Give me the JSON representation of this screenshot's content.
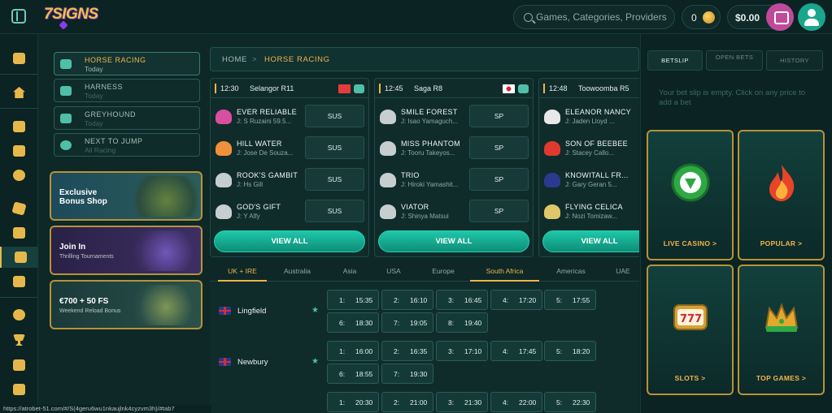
{
  "header": {
    "logo_text": "7SIGNS",
    "search_placeholder": "Games, Categories, Providers",
    "coins": "0",
    "balance": "$0.00"
  },
  "subnav": [
    {
      "label": "HORSE RACING",
      "sub": "Today"
    },
    {
      "label": "HARNESS",
      "sub": "Today"
    },
    {
      "label": "GREYHOUND",
      "sub": "Today"
    },
    {
      "label": "NEXT TO JUMP",
      "sub": "All Racing"
    }
  ],
  "promos": [
    {
      "title": "Exclusive",
      "title2": "Bonus Shop",
      "sub": ""
    },
    {
      "title": "Join In",
      "title2": "",
      "sub": "Thrilling Tournaments"
    },
    {
      "title": "€700 + 50 FS",
      "title2": "",
      "sub": "Weekend Reload Bonus"
    }
  ],
  "breadcrumb": {
    "home": "HOME",
    "separator": ">",
    "current": "HORSE RACING"
  },
  "races": [
    {
      "time": "12:30",
      "venue": "Selangor R11",
      "flag_color": "#e43b3b",
      "runners": [
        {
          "name": "EVER RELIABLE",
          "jockey": "J: S Ruzaini 59.5...",
          "odds": "SUS",
          "silk": "#d84fa0"
        },
        {
          "name": "HILL WATER",
          "jockey": "J: Jose De Souza...",
          "odds": "SUS",
          "silk": "#f0903a"
        },
        {
          "name": "ROOK'S GAMBIT",
          "jockey": "J: Hs Gill",
          "odds": "SUS",
          "silk": "#c7ced0"
        },
        {
          "name": "GOD'S GIFT",
          "jockey": "J: Y Alfy",
          "odds": "SUS",
          "silk": "#c7ced0"
        }
      ],
      "view_all": "VIEW ALL"
    },
    {
      "time": "12:45",
      "venue": "Saga R8",
      "flag_color": "#ffffff",
      "runners": [
        {
          "name": "SMILE FOREST",
          "jockey": "J: Isao Yamaguch...",
          "odds": "SP",
          "silk": "#c7ced0"
        },
        {
          "name": "MISS PHANTOM",
          "jockey": "J: Tooru Takeyos...",
          "odds": "SP",
          "silk": "#c7ced0"
        },
        {
          "name": "TRIO",
          "jockey": "J: Hiroki Yamashit...",
          "odds": "SP",
          "silk": "#c7ced0"
        },
        {
          "name": "VIATOR",
          "jockey": "J: Shinya Matsui",
          "odds": "SP",
          "silk": "#c7ced0"
        }
      ],
      "view_all": "VIEW ALL"
    },
    {
      "time": "12:48",
      "venue": "Toowoomba R5",
      "flag_color": "",
      "runners": [
        {
          "name": "ELEANOR NANCY",
          "jockey": "J: Jaden Lloyd ...",
          "odds": "",
          "silk": "#e8e8e8"
        },
        {
          "name": "SON OF BEEBEE",
          "jockey": "J: Stacey Callo...",
          "odds": "",
          "silk": "#e03a2e"
        },
        {
          "name": "KNOWITALL FR...",
          "jockey": "J: Gary Geran 5...",
          "odds": "",
          "silk": "#2b3a8f"
        },
        {
          "name": "FLYING CELICA",
          "jockey": "J: Nozi Tomizaw...",
          "odds": "",
          "silk": "#e0c86a"
        }
      ],
      "view_all": "VIEW ALL"
    }
  ],
  "regions": [
    "UK + IRE",
    "Australia",
    "Asia",
    "USA",
    "Europe",
    "South Africa",
    "Americas",
    "UAE"
  ],
  "meetings": [
    {
      "name": "Lingfield",
      "races": [
        {
          "n": "1:",
          "t": "15:35"
        },
        {
          "n": "2:",
          "t": "16:10"
        },
        {
          "n": "3:",
          "t": "16:45"
        },
        {
          "n": "4:",
          "t": "17:20"
        },
        {
          "n": "5:",
          "t": "17:55"
        },
        {
          "n": "6:",
          "t": "18:30"
        },
        {
          "n": "7:",
          "t": "19:05"
        },
        {
          "n": "8:",
          "t": "19:40"
        }
      ]
    },
    {
      "name": "Newbury",
      "races": [
        {
          "n": "1:",
          "t": "16:00"
        },
        {
          "n": "2:",
          "t": "16:35"
        },
        {
          "n": "3:",
          "t": "17:10"
        },
        {
          "n": "4:",
          "t": "17:45"
        },
        {
          "n": "5:",
          "t": "18:20"
        },
        {
          "n": "6:",
          "t": "18:55"
        },
        {
          "n": "7:",
          "t": "19:30"
        }
      ]
    },
    {
      "name": "",
      "races": [
        {
          "n": "1:",
          "t": "20:30"
        },
        {
          "n": "2:",
          "t": "21:00"
        },
        {
          "n": "3:",
          "t": "21:30"
        },
        {
          "n": "4:",
          "t": "22:00"
        },
        {
          "n": "5:",
          "t": "22:30"
        }
      ]
    }
  ],
  "betslip": {
    "tabs": [
      "BETSLIP",
      "OPEN BETS",
      "HISTORY"
    ],
    "empty_message": "Your bet slip is empty. Click on any price to add a bet",
    "games": [
      {
        "label": "LIVE CASINO",
        "arrow": ">",
        "icon": "live-casino-chip-icon"
      },
      {
        "label": "POPULAR",
        "arrow": ">",
        "icon": "flame-icon"
      },
      {
        "label": "SLOTS",
        "arrow": ">",
        "icon": "slot-machine-icon"
      },
      {
        "label": "TOP GAMES",
        "arrow": ">",
        "icon": "crown-icon"
      }
    ]
  },
  "statusbar": {
    "url": "https://atrobet-51.com/#/S(4geru6wu1nkaujlnk4cyzvm3h)/#tab7"
  },
  "colors": {
    "accent": "#f0b44c",
    "teal": "#1ec7a8",
    "bg": "#0d2826",
    "gold_border": "#b7923b"
  }
}
